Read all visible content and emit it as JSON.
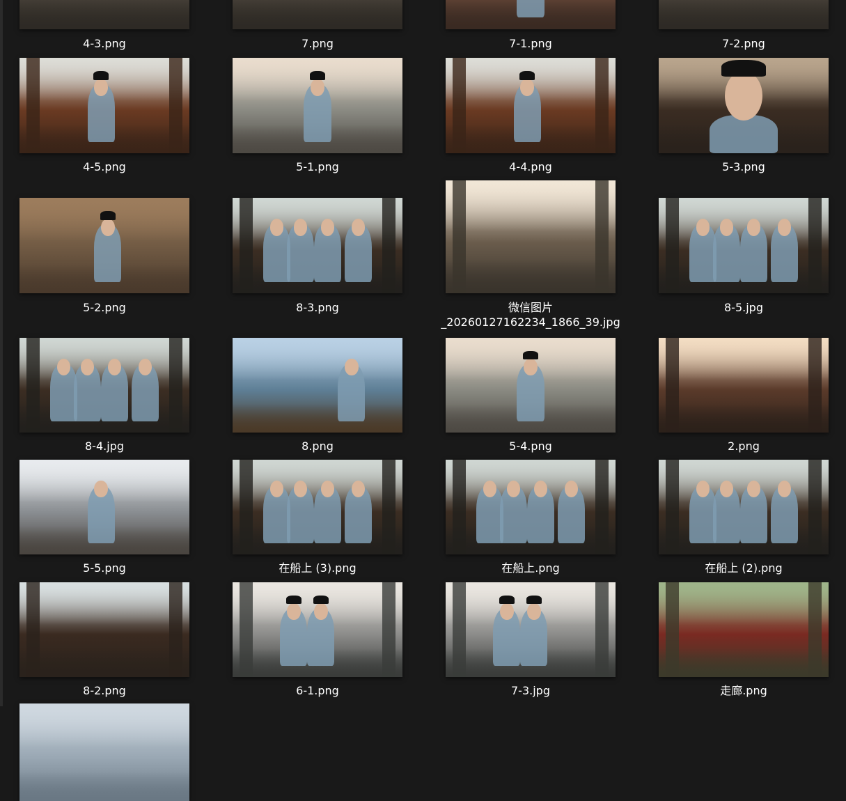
{
  "files": [
    {
      "name": "4-3.png",
      "tone": "street"
    },
    {
      "name": "7.png",
      "tone": "street"
    },
    {
      "name": "7-1.png",
      "tone": "warm"
    },
    {
      "name": "7-2.png",
      "tone": "street"
    },
    {
      "name": "4-5.png",
      "tone": "room"
    },
    {
      "name": "5-1.png",
      "tone": "porter"
    },
    {
      "name": "4-4.png",
      "tone": "room"
    },
    {
      "name": "5-3.png",
      "tone": "portrait"
    },
    {
      "name": "5-2.png",
      "tone": "courtyard"
    },
    {
      "name": "8-3.png",
      "tone": "boat"
    },
    {
      "name": "微信图片\n_20260127162234_1866_39.jpg",
      "tone": "alley"
    },
    {
      "name": "8-5.jpg",
      "tone": "boat"
    },
    {
      "name": "8-4.jpg",
      "tone": "boat"
    },
    {
      "name": "8.png",
      "tone": "river"
    },
    {
      "name": "5-4.png",
      "tone": "porter"
    },
    {
      "name": "2.png",
      "tone": "gate"
    },
    {
      "name": "5-5.png",
      "tone": "doorway"
    },
    {
      "name": "在船上 (3).png",
      "tone": "boat"
    },
    {
      "name": "在船上.png",
      "tone": "boat"
    },
    {
      "name": "在船上 (2).png",
      "tone": "boat"
    },
    {
      "name": "8-2.png",
      "tone": "boat-empty"
    },
    {
      "name": "6-1.png",
      "tone": "wall"
    },
    {
      "name": "7-3.jpg",
      "tone": "wall"
    },
    {
      "name": "走廊.png",
      "tone": "corridor"
    },
    {
      "name": "",
      "tone": "partial"
    }
  ],
  "palette": {
    "background": "#191919",
    "caption_text": "#ffffff",
    "street": [
      "#8a7f6f",
      "#4d463d",
      "#2e2a25"
    ],
    "warm": [
      "#c99a7a",
      "#6b4a3a",
      "#3a2a22"
    ],
    "room": [
      "#dcdcd6",
      "#6a3a22",
      "#3a2418"
    ],
    "porter": [
      "#e9dccd",
      "#8a8a82",
      "#4e4a44"
    ],
    "portrait": [
      "#b8a48c",
      "#3a2c22",
      "#2a221c"
    ],
    "courtyard": [
      "#9c7c5c",
      "#6e5842",
      "#4a3a2c"
    ],
    "boat": [
      "#cfd6d2",
      "#3b2d22",
      "#22201d"
    ],
    "alley": [
      "#f1e6d6",
      "#6a5c4c",
      "#3a342c"
    ],
    "river": [
      "#b9d0e4",
      "#5e7f96",
      "#4b3a28"
    ],
    "gate": [
      "#f2dcc2",
      "#5a3a2a",
      "#2c211a"
    ],
    "doorway": [
      "#e8ebee",
      "#8a8e92",
      "#4a4540"
    ],
    "boat-empty": [
      "#d8dfe0",
      "#3a2a20",
      "#2a221c"
    ],
    "wall": [
      "#eae6e0",
      "#8c8c8a",
      "#3a3c3a"
    ],
    "corridor": [
      "#9fb58a",
      "#7a2a22",
      "#3c3a2a"
    ],
    "partial": [
      "#cfd8e0",
      "#9aa8b4",
      "#6a7884"
    ]
  }
}
